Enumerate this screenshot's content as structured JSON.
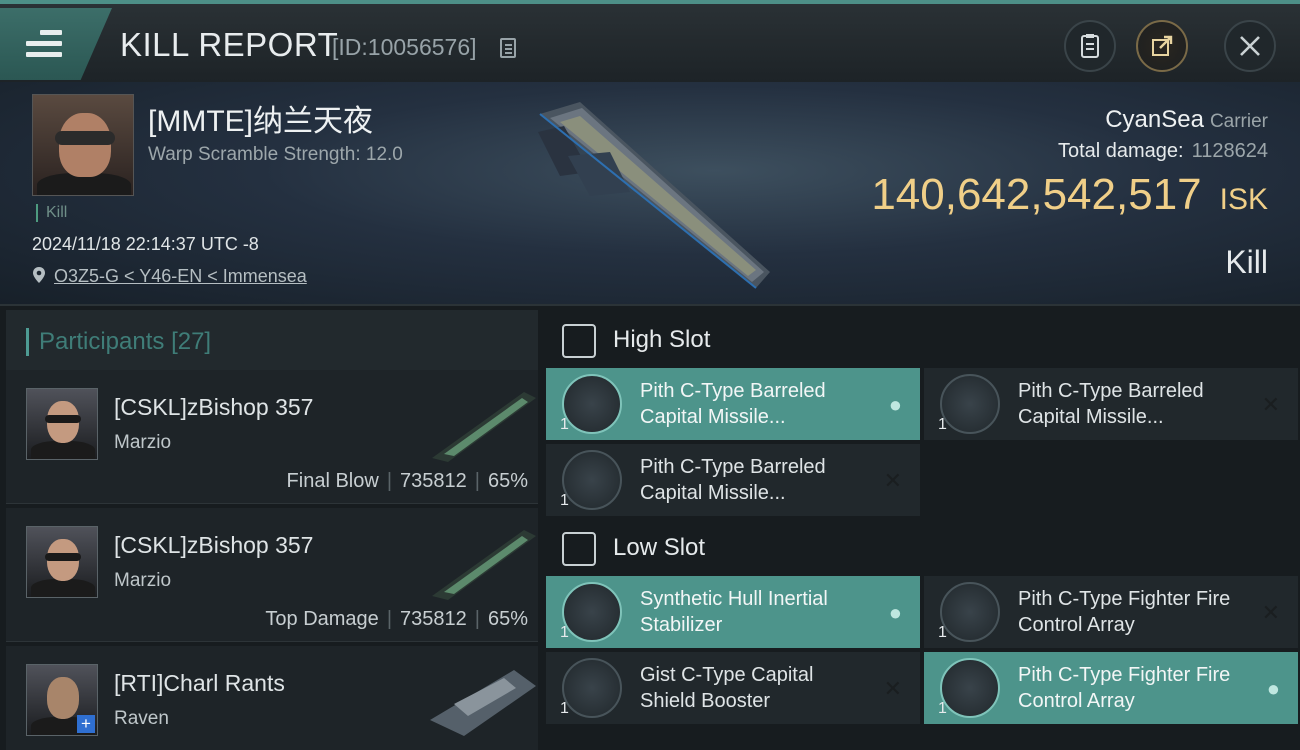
{
  "header": {
    "title": "KILL REPORT",
    "report_id": "[ID:10056576]"
  },
  "victim": {
    "name": "[MMTE]纳兰天夜",
    "warp_scramble": "Warp Scramble Strength: 12.0",
    "kill_tag": "Kill",
    "timestamp": "2024/11/18 22:14:37 UTC -8",
    "location": "O3Z5-G < Y46-EN < Immensea",
    "ship_name": "CyanSea",
    "ship_type": "Carrier",
    "total_damage_label": "Total damage:",
    "total_damage": "1128624",
    "isk_value": "140,642,542,517",
    "isk_unit": "ISK",
    "result": "Kill"
  },
  "participants": {
    "label": "Participants",
    "count": "[27]",
    "rows": [
      {
        "name": "[CSKL]zBishop 357",
        "ship": "Marzio",
        "role": "Final Blow",
        "damage": "735812",
        "percent": "65%"
      },
      {
        "name": "[CSKL]zBishop 357",
        "ship": "Marzio",
        "role": "Top Damage",
        "damage": "735812",
        "percent": "65%"
      },
      {
        "name": "[RTI]Charl Rants",
        "ship": "Raven",
        "role": "",
        "damage": "",
        "percent": ""
      }
    ]
  },
  "slots": {
    "high": {
      "label": "High Slot",
      "modules": [
        {
          "name": "Pith C-Type Barreled Capital Missile...",
          "qty": "1",
          "status": "dropped"
        },
        {
          "name": "Pith C-Type Barreled Capital Missile...",
          "qty": "1",
          "status": "destroyed"
        },
        {
          "name": "Pith C-Type Barreled Capital Missile...",
          "qty": "1",
          "status": "destroyed"
        }
      ]
    },
    "low": {
      "label": "Low Slot",
      "modules": [
        {
          "name": "Synthetic Hull Inertial Stabilizer",
          "qty": "1",
          "status": "dropped"
        },
        {
          "name": "Pith C-Type Fighter Fire Control Array",
          "qty": "1",
          "status": "destroyed"
        },
        {
          "name": "Gist C-Type Capital Shield Booster",
          "qty": "1",
          "status": "destroyed"
        },
        {
          "name": "Pith C-Type Fighter Fire Control Array",
          "qty": "1",
          "status": "dropped"
        }
      ]
    }
  },
  "colors": {
    "accent": "#4d948b",
    "isk": "#f0cf88"
  }
}
